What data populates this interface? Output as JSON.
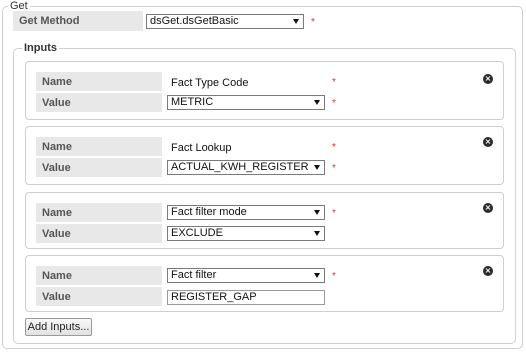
{
  "get": {
    "legend": "Get",
    "method_label": "Get Method",
    "method_value": "dsGet.dsGetBasic",
    "required_mark": "*"
  },
  "inputs": {
    "legend": "Inputs",
    "add_button_label": "Add Inputs...",
    "required_mark": "*",
    "name_label": "Name",
    "value_label": "Value",
    "items": [
      {
        "name": "Fact Type Code",
        "value": "METRIC"
      },
      {
        "name": "Fact Lookup",
        "value": "ACTUAL_KWH_REGISTER"
      },
      {
        "name": "Fact filter mode",
        "value": "EXCLUDE"
      },
      {
        "name": "Fact filter",
        "value": "REGISTER_GAP"
      }
    ]
  },
  "colors": {
    "required": "#e03030",
    "label_bg": "#e8e8e8",
    "border": "#cfcfcf"
  },
  "icons": {
    "remove": "close-icon",
    "dropdown": "chevron-down-icon"
  }
}
